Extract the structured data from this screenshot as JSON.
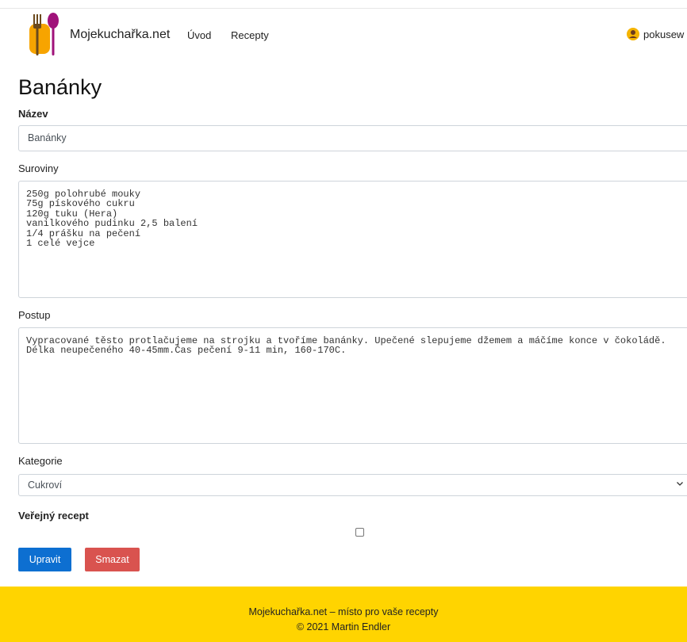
{
  "navbar": {
    "brand": "Mojekuchařka.net",
    "links": [
      "Úvod",
      "Recepty"
    ],
    "user": "pokusew"
  },
  "page": {
    "title": "Banánky"
  },
  "form": {
    "nazev_label": "Název",
    "nazev_value": "Banánky",
    "suroviny_label": "Suroviny",
    "suroviny_value": "250g polohrubé mouky\n75g pískového cukru\n120g tuku (Hera)\nvanilkového pudinku 2,5 balení\n1/4 prášku na pečení\n1 celé vejce",
    "postup_label": "Postup",
    "postup_value": "Vypracované těsto protlačujeme na strojku a tvoříme banánky. Upečené slepujeme džemem a máčíme konce v čokoládě. Délka neupečeného 40-45mm.Čas pečení 9-11 min, 160-170C.",
    "kategorie_label": "Kategorie",
    "kategorie_value": "Cukroví",
    "verejny_label": "Veřejný recept",
    "verejny_checked": false
  },
  "buttons": {
    "edit": "Upravit",
    "delete": "Smazat"
  },
  "footer": {
    "line1": "Mojekuchařka.net – místo pro vaše recepty",
    "line2": "© 2021 Martin Endler"
  },
  "colors": {
    "primary": "#0d6fd1",
    "danger": "#d9534f",
    "footer_bg": "#ffd400",
    "logo_orange": "#f7a400",
    "logo_purple": "#a0127a"
  },
  "icons": {
    "logo": "cutlery-logo-icon",
    "user": "user-avatar-icon",
    "select": "chevron-down-icon"
  }
}
